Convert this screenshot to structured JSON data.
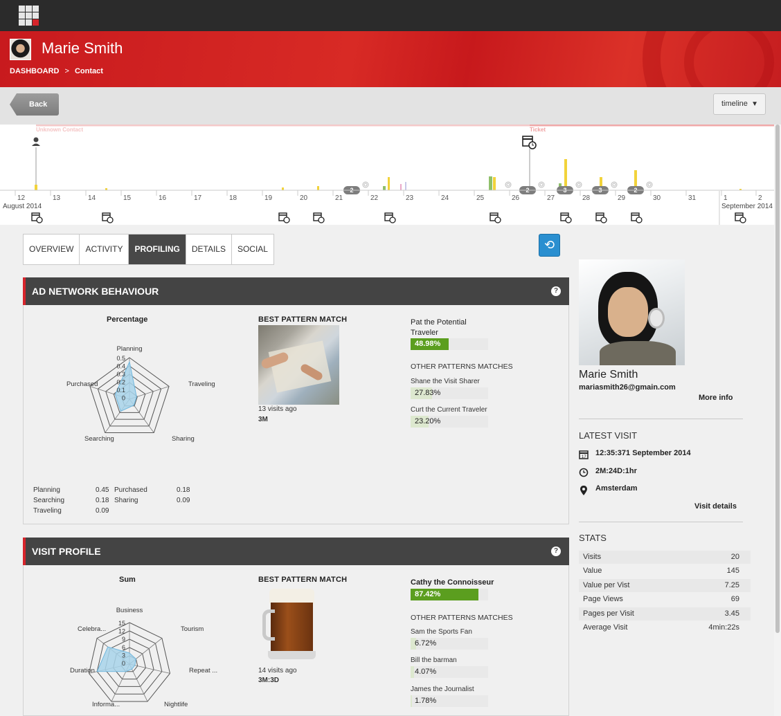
{
  "header": {
    "contact_name": "Marie Smith",
    "breadcrumb": {
      "root": "DASHBOARD",
      "separator": ">",
      "current": "Contact"
    }
  },
  "toolbar": {
    "back_label": "Back",
    "view_select": "timeline"
  },
  "timeline": {
    "segments": [
      {
        "label": "Unknown Contact"
      },
      {
        "label": "Ticket"
      }
    ],
    "day_labels": [
      "12",
      "13",
      "14",
      "15",
      "16",
      "17",
      "18",
      "19",
      "20",
      "21",
      "22",
      "23",
      "24",
      "25",
      "26",
      "27",
      "28",
      "29",
      "30",
      "31",
      "1",
      "2"
    ],
    "month_labels": [
      "August 2014",
      "September 2014"
    ],
    "badges": [
      "2",
      "2",
      "3",
      "3",
      "2"
    ]
  },
  "tabs": [
    {
      "label": "OVERVIEW",
      "active": false
    },
    {
      "label": "ACTIVITY",
      "active": false
    },
    {
      "label": "PROFILING",
      "active": true
    },
    {
      "label": "DETAILS",
      "active": false
    },
    {
      "label": "SOCIAL",
      "active": false
    }
  ],
  "ad_network": {
    "title": "AD NETWORK BEHAVIOUR",
    "radar_title": "Percentage",
    "radar_axes": [
      "Planning",
      "Traveling",
      "Sharing",
      "Searching",
      "Purchased"
    ],
    "radar_ticks": [
      "0.5",
      "0.4",
      "0.3",
      "0.2",
      "0.1",
      "0"
    ],
    "legend": {
      "planning_label": "Planning",
      "planning_value": "0.45",
      "purchased_label": "Purchased",
      "purchased_value": "0.18",
      "searching_label": "Searching",
      "searching_value": "0.18",
      "sharing_label": "Sharing",
      "sharing_value": "0.09",
      "traveling_label": "Traveling",
      "traveling_value": "0.09"
    },
    "best_pattern_label": "BEST PATTERN MATCH",
    "visits_ago": "13 visits ago",
    "duration": "3M",
    "primary_match": {
      "name": "Pat the Potential Traveler",
      "percent": "48.98%",
      "fraction": 0.4898
    },
    "others_label": "OTHER PATTERNS MATCHES",
    "others": [
      {
        "name": "Shane the Visit Sharer",
        "percent": "27.83%",
        "fraction": 0.2783
      },
      {
        "name": "Curt the Current Traveler",
        "percent": "23.20%",
        "fraction": 0.232
      }
    ]
  },
  "visit_profile": {
    "title": "VISIT PROFILE",
    "radar_title": "Sum",
    "radar_axes": [
      "Business",
      "Tourism",
      "Repeat ...",
      "Nightlife",
      "Informa...",
      "Duration",
      "Celebra..."
    ],
    "radar_ticks": [
      "15",
      "12",
      "9",
      "6",
      "3",
      "0"
    ],
    "best_pattern_label": "BEST PATTERN MATCH",
    "visits_ago": "14 visits ago",
    "duration": "3M:3D",
    "primary_match": {
      "name": "Cathy the Connoisseur",
      "percent": "87.42%",
      "fraction": 0.8742
    },
    "others_label": "OTHER PATTERNS MATCHES",
    "others": [
      {
        "name": "Sam the Sports Fan",
        "percent": "6.72%",
        "fraction": 0.0672
      },
      {
        "name": "Bill the barman",
        "percent": "4.07%",
        "fraction": 0.0407
      },
      {
        "name": "James the Journalist",
        "percent": "1.78%",
        "fraction": 0.0178
      }
    ]
  },
  "profile": {
    "name": "Marie Smith",
    "email": "mariasmith26@gmain.com",
    "more_info": "More info"
  },
  "latest_visit": {
    "title": "LATEST VISIT",
    "date": "12:35:371 September 2014",
    "duration": "2M:24D:1hr",
    "location": "Amsterdam",
    "details_link": "Visit details"
  },
  "stats": {
    "title": "STATS",
    "rows": [
      {
        "label": "Visits",
        "value": "20"
      },
      {
        "label": "Value",
        "value": "145"
      },
      {
        "label": "Value per Vist",
        "value": "7.25"
      },
      {
        "label": "Page Views",
        "value": "69"
      },
      {
        "label": "Pages per Visit",
        "value": "3.45"
      },
      {
        "label": "Average Visit",
        "value": "4min:22s"
      }
    ]
  },
  "colors": {
    "brand_red": "#d6242b",
    "accent_blue": "#2a8fd0",
    "match_green": "#5b9e1f",
    "radar_fill": "#a8d4ea",
    "event_yellow": "#f2d33b"
  }
}
